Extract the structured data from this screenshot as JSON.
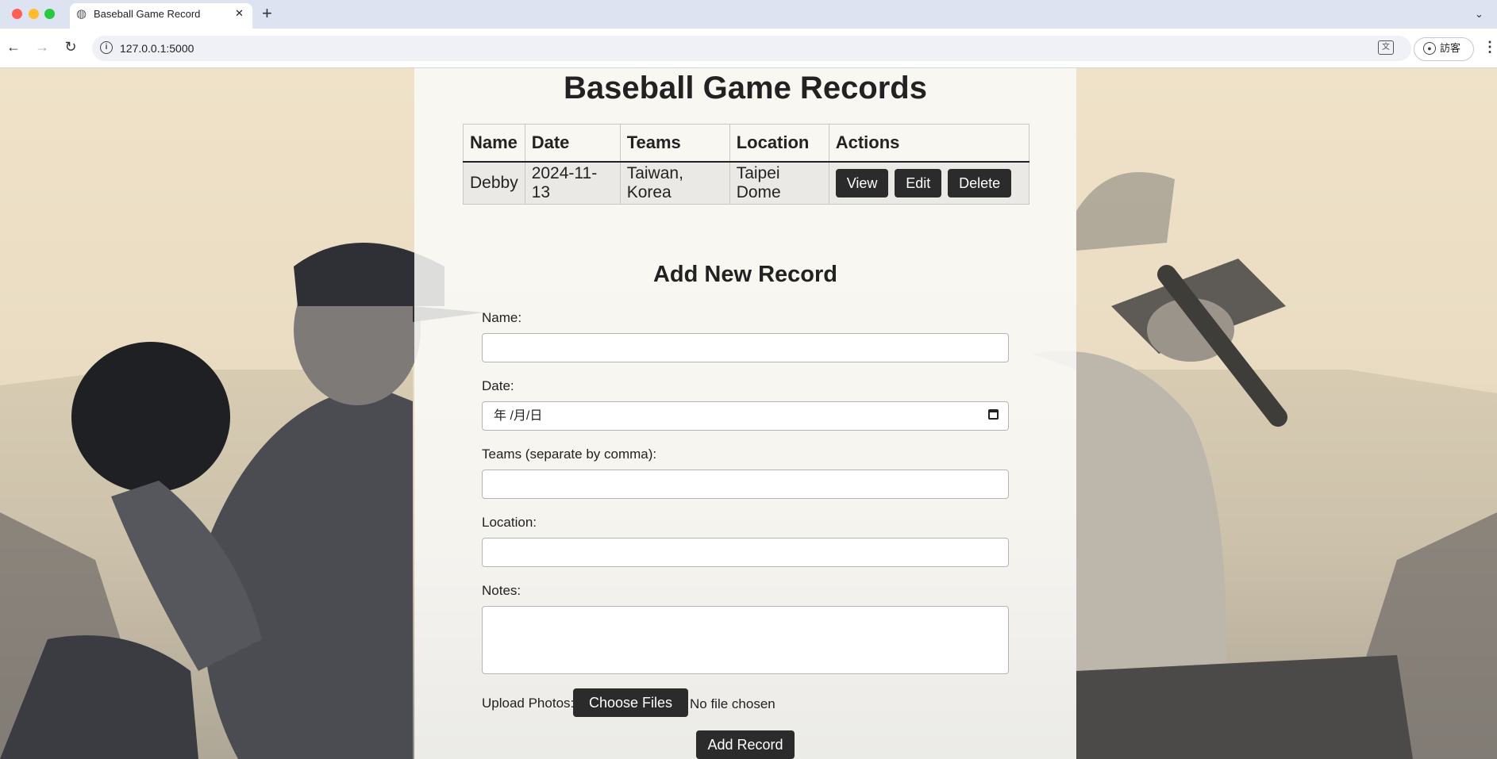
{
  "browser": {
    "tab_title": "Baseball Game Record",
    "tab_close": "✕",
    "new_tab": "+",
    "url": "127.0.0.1:5000",
    "profile_label": "訪客"
  },
  "page": {
    "title": "Baseball Game Records",
    "table": {
      "headers": [
        "Name",
        "Date",
        "Teams",
        "Location",
        "Actions"
      ],
      "rows": [
        {
          "name": "Debby",
          "date": "2024-11-13",
          "teams": "Taiwan, Korea",
          "location": "Taipei Dome"
        }
      ],
      "actions": {
        "view": "View",
        "edit": "Edit",
        "delete": "Delete"
      }
    },
    "form": {
      "title": "Add New Record",
      "name_label": "Name:",
      "name_value": "",
      "date_label": "Date:",
      "date_value": "年 /月/日",
      "teams_label": "Teams (separate by comma):",
      "teams_value": "",
      "location_label": "Location:",
      "location_value": "",
      "notes_label": "Notes:",
      "notes_value": "",
      "upload_label": "Upload Photos:",
      "choose_files": "Choose Files",
      "file_status": "No file chosen",
      "submit": "Add Record"
    }
  },
  "colors": {
    "button_dark": "#2b2b2b",
    "background_sepia": "#efe2c8",
    "tab_strip": "#dee3f1"
  }
}
